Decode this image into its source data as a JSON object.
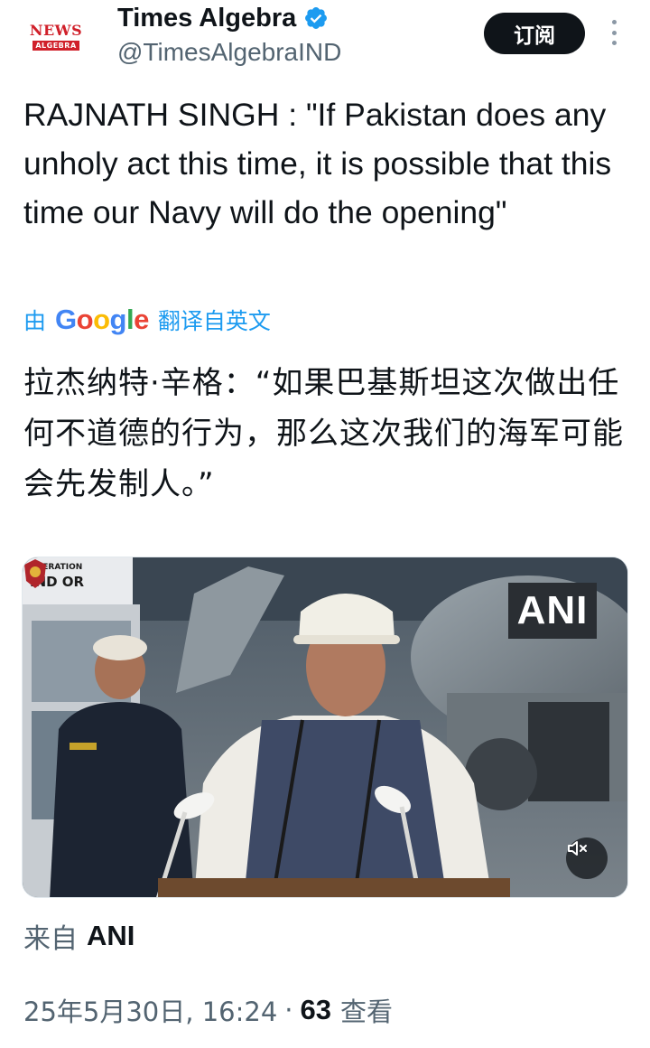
{
  "account": {
    "avatar_line1": "NEWS",
    "avatar_line2": "ALGEBRA",
    "display_name": "Times Algebra",
    "handle": "@TimesAlgebraIND",
    "verified": true,
    "subscribe_label": "订阅"
  },
  "tweet": {
    "text": "RAJNATH SINGH : \"If Pakistan does any unholy act this time, it is possible that this time our Navy will do the opening\"",
    "translate_prefix": "由",
    "translate_brand": "Google",
    "translate_suffix": "翻译自英文",
    "translated_text": "拉杰纳特·辛格：“如果巴基斯坦这次做出任何不道德的行为，那么这次我们的海军可能会先发制人。”"
  },
  "media": {
    "watermark": "ANI",
    "badge_line1": "OPERATION",
    "badge_line2": "IND  OR",
    "mute_icon": "volume-mute-icon"
  },
  "source": {
    "prefix": "来自",
    "name": "ANI"
  },
  "meta": {
    "timestamp": "25年5月30日, 16:24",
    "separator": "·",
    "views_count": "63",
    "views_label": "查看"
  },
  "colors": {
    "link": "#1d9bf0",
    "text": "#0f1419",
    "secondary": "#536471",
    "button_bg": "#0f1419",
    "verified": "#1d9bf0"
  }
}
